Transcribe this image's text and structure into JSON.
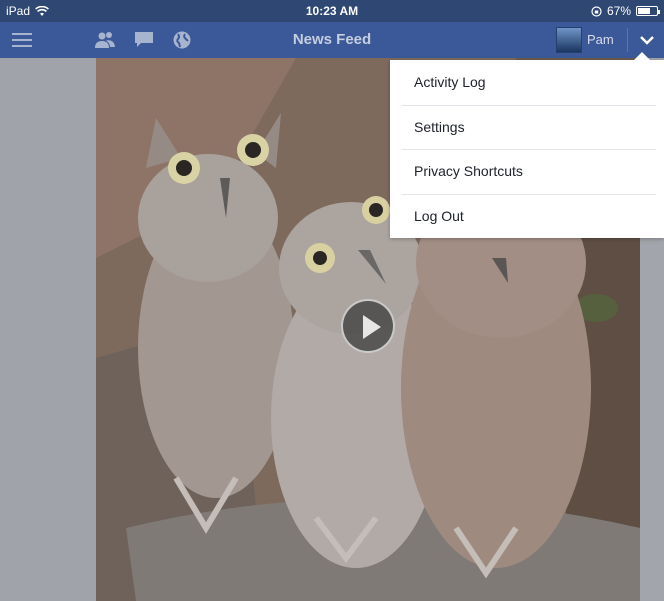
{
  "status_bar": {
    "device": "iPad",
    "time": "10:23 AM",
    "battery_percent_label": "67%",
    "battery_level": 0.67
  },
  "navbar": {
    "title": "News Feed",
    "user_name": "Pam",
    "icons": [
      "menu-icon",
      "friends-icon",
      "messages-icon",
      "globe-icon",
      "chevron-down-icon"
    ],
    "colors": {
      "statusbar": "#2f4773",
      "navbar": "#3b5998"
    }
  },
  "dropdown": {
    "items": [
      {
        "label": "Activity Log"
      },
      {
        "label": "Settings"
      },
      {
        "label": "Privacy Shortcuts"
      },
      {
        "label": "Log Out"
      }
    ]
  },
  "media": {
    "kind": "video",
    "play_icon": "play-icon"
  }
}
